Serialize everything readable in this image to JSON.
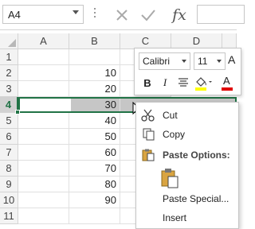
{
  "formula_bar": {
    "name_box": "A4",
    "fx_label": "fx",
    "formula_value": ""
  },
  "columns": [
    "A",
    "B",
    "C",
    "D"
  ],
  "rows": [
    "1",
    "2",
    "3",
    "4",
    "5",
    "6",
    "7",
    "8",
    "9",
    "10",
    "11"
  ],
  "column_b_values": [
    "",
    "10",
    "20",
    "30",
    "40",
    "50",
    "60",
    "70",
    "80",
    "90",
    ""
  ],
  "mini_toolbar": {
    "font_name": "Calibri",
    "font_size": "11",
    "bold_label": "B",
    "italic_label": "I",
    "grow_font_label": "A",
    "font_color_label": "A"
  },
  "context_menu": {
    "cut": "Cut",
    "copy": "Copy",
    "paste_options_header": "Paste Options:",
    "paste_special": "Paste Special...",
    "insert": "Insert"
  },
  "colors": {
    "excel_green": "#217346",
    "selection_gray": "#c6c6c6",
    "highlight_yellow": "#ffff00",
    "font_red": "#e00000"
  }
}
